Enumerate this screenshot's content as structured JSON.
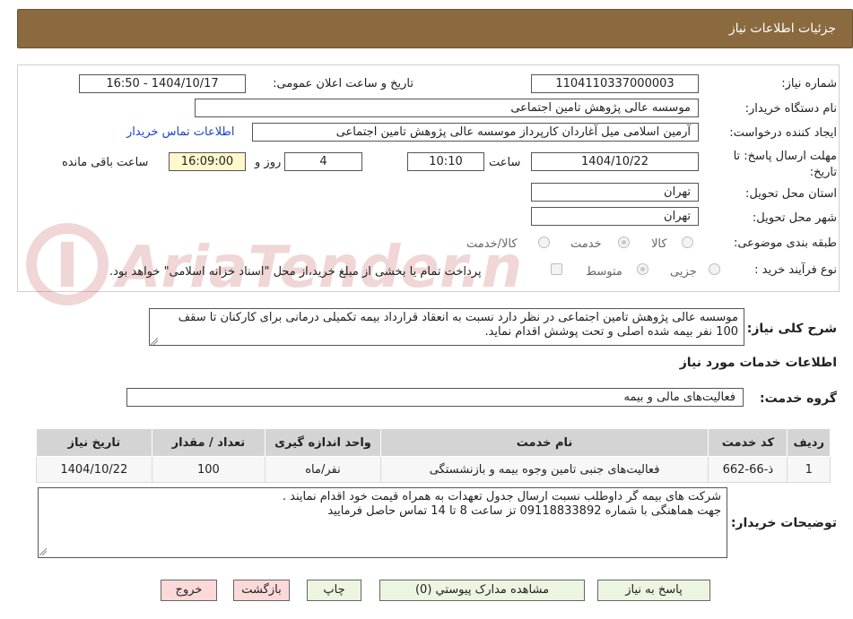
{
  "header": {
    "title": "جزئیات اطلاعات نیاز"
  },
  "need_number": {
    "label": "شماره نیاز:",
    "value": "1104110337000003"
  },
  "announce": {
    "label": "تاریخ و ساعت اعلان عمومی:",
    "value": "1404/10/17 - 16:50"
  },
  "buyer": {
    "label": "نام دستگاه خریدار:",
    "value": "موسسه عالی پژوهش تامین اجتماعی"
  },
  "creator": {
    "label": "ایجاد کننده درخواست:",
    "value": "آرمین اسلامی میل آغاردان کارپرداز موسسه عالی پژوهش تامین اجتماعی",
    "contact_link": "اطلاعات تماس خریدار"
  },
  "deadline": {
    "label": "مهلت ارسال پاسخ: تا تاریخ:",
    "date": "1404/10/22",
    "time_label": "ساعت",
    "time": "10:10",
    "days": "4",
    "days_label": "روز و",
    "remaining": "16:09:00",
    "remaining_label": "ساعت باقی مانده"
  },
  "province": {
    "label": "استان محل تحویل:",
    "value": "تهران"
  },
  "city": {
    "label": "شهر محل تحویل:",
    "value": "تهران"
  },
  "category": {
    "label": "طبقه بندی موضوعی:",
    "options": [
      "کالا",
      "خدمت",
      "کالا/خدمت"
    ],
    "selected": "خدمت"
  },
  "process": {
    "label": "نوع فرآیند خرید :",
    "options": [
      "جزیی",
      "متوسط"
    ],
    "selected": "متوسط",
    "note": "پرداخت تمام یا بخشی از مبلغ خرید،از محل \"اسناد خزانه اسلامی\" خواهد بود."
  },
  "summary": {
    "label": "شرح کلی نیاز:",
    "text": "موسسه عالی پژوهش تامین اجتماعی در نظر دارد نسبت به انعقاد قرارداد بیمه تکمیلی درمانی برای کارکنان تا سقف 100 نفر بیمه شده اصلی و تحت پوشش اقدام نماید."
  },
  "services_title": "اطلاعات خدمات مورد نیاز",
  "service_group": {
    "label": "گروه خدمت:",
    "value": "فعالیت‌های مالی و بیمه"
  },
  "table": {
    "headers": [
      "ردیف",
      "کد خدمت",
      "نام خدمت",
      "واحد اندازه گیری",
      "تعداد / مقدار",
      "تاریخ نیاز"
    ],
    "rows": [
      [
        "1",
        "ذ-66-662",
        "فعالیت‌های جنبی تامین وجوه بیمه و بازنشستگی",
        "نفر/ماه",
        "100",
        "1404/10/22"
      ]
    ]
  },
  "buyer_notes": {
    "label": "توضیحات خریدار:",
    "line1": "شرکت های بیمه گر داوطلب نسبت ارسال جدول تعهدات به همراه قیمت  خود اقدام نمایند .",
    "line2": "جهت هماهنگی با شماره 09118833892 تز ساعت 8 تا 14 تماس حاصل فرمایید"
  },
  "buttons": {
    "reply": "پاسخ به نیاز",
    "attachments": "مشاهده مدارک پیوستي (0)",
    "print": "چاپ",
    "back": "بازگشت",
    "exit": "خروج"
  },
  "watermark": {
    "text": "AriaTender.neT"
  },
  "colors": {
    "header": "#8a6a3e",
    "button_green": "#ecf5e0",
    "button_red": "#fbd9d9",
    "link": "#1b43c9",
    "countdown": "#fff8cc"
  }
}
